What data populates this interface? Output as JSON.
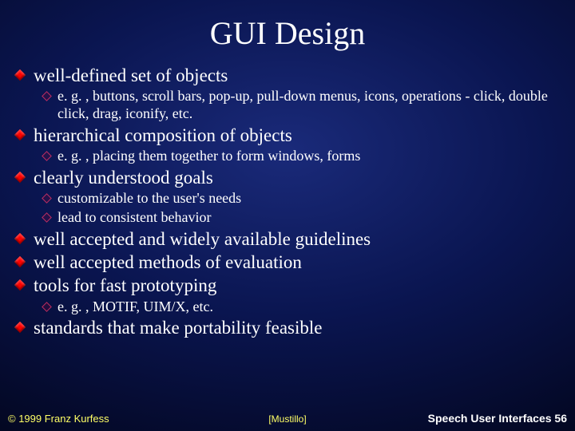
{
  "title": "GUI Design",
  "bullets": {
    "b1": "well-defined set of objects",
    "b1_1": "e. g. , buttons, scroll bars, pop-up, pull-down menus, icons, operations - click, double click, drag, iconify, etc.",
    "b2": "hierarchical composition of objects",
    "b2_1": "e. g. , placing them together to form windows, forms",
    "b3": "clearly understood goals",
    "b3_1": "customizable to the user's needs",
    "b3_2": "lead to consistent behavior",
    "b4": "well accepted and widely available guidelines",
    "b5": "well accepted methods of evaluation",
    "b6": "tools for fast prototyping",
    "b6_1": "e. g. , MOTIF, UIM/X, etc.",
    "b7": "standards that make portability feasible"
  },
  "footer": {
    "copyright": "© 1999 Franz Kurfess",
    "citation": "[Mustillo]",
    "page_label": "Speech User Interfaces  56"
  }
}
